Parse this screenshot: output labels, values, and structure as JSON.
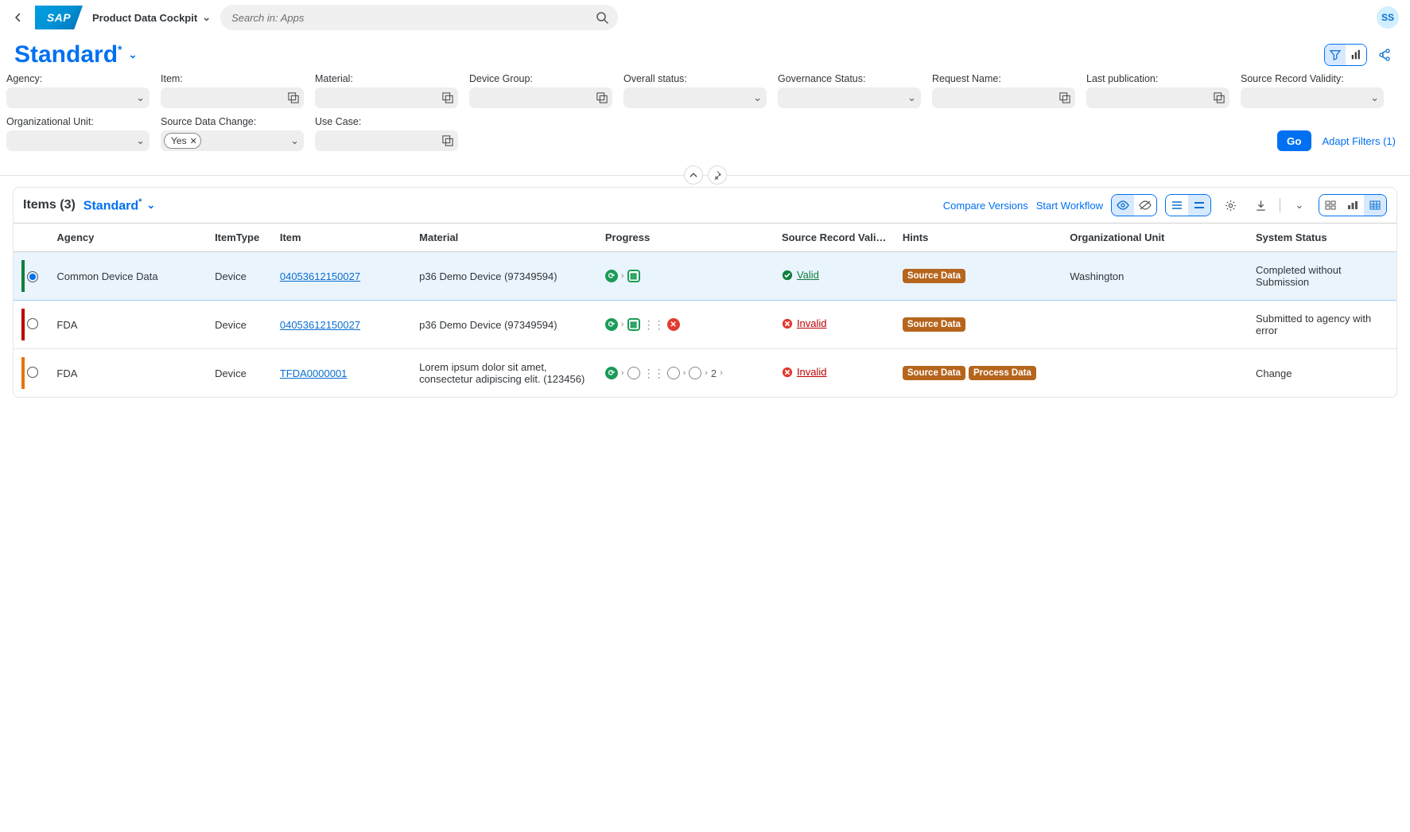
{
  "shell": {
    "app_title": "Product Data Cockpit",
    "search_placeholder": "Search in: Apps",
    "avatar_initials": "SS"
  },
  "pageHeader": {
    "variant_name": "Standard"
  },
  "filters": {
    "labels": {
      "agency": "Agency:",
      "item": "Item:",
      "material": "Material:",
      "device_group": "Device Group:",
      "overall_status": "Overall status:",
      "governance_status": "Governance Status:",
      "request_name": "Request Name:",
      "last_publication": "Last publication:",
      "source_record_validity": "Source Record Validity:",
      "organizational_unit": "Organizational Unit:",
      "source_data_change": "Source Data Change:",
      "use_case": "Use Case:"
    },
    "source_data_change_token": "Yes",
    "go_label": "Go",
    "adapt_label": "Adapt Filters (1)"
  },
  "tableHeader": {
    "items_title": "Items (3)",
    "variant": "Standard",
    "compare": "Compare Versions",
    "start_workflow": "Start Workflow"
  },
  "columns": {
    "agency": "Agency",
    "itemType": "ItemType",
    "item": "Item",
    "material": "Material",
    "progress": "Progress",
    "srv": "Source Record Vali…",
    "hints": "Hints",
    "org": "Organizational Unit",
    "sys": "System Status"
  },
  "rows": [
    {
      "selected": true,
      "indicator_color": "#107e3e",
      "agency": "Common Device Data",
      "itemType": "Device",
      "item_link": "04053612150027",
      "material": "p36 Demo Device (97349594)",
      "progress_kind": "ok2",
      "validity": {
        "state": "ok",
        "label": "Valid"
      },
      "hints": [
        "Source Data"
      ],
      "org": "Washington",
      "sys": "Completed without Submission"
    },
    {
      "selected": false,
      "indicator_color": "#bb0000",
      "agency": "FDA",
      "itemType": "Device",
      "item_link": "04053612150027",
      "material": "p36 Demo Device (97349594)",
      "progress_kind": "err",
      "validity": {
        "state": "bad",
        "label": "Invalid"
      },
      "hints": [
        "Source Data"
      ],
      "org": "",
      "sys": "Submitted to agency with error"
    },
    {
      "selected": false,
      "indicator_color": "#e9730c",
      "agency": "FDA",
      "itemType": "Device",
      "item_link": "TFDA0000001",
      "material": "Lorem ipsum dolor sit amet, consectetur adipiscing elit. (123456)",
      "progress_kind": "long",
      "progress_tail": "2",
      "validity": {
        "state": "bad",
        "label": "Invalid"
      },
      "hints": [
        "Source Data",
        "Process Data"
      ],
      "org": "",
      "sys": "Change"
    }
  ]
}
